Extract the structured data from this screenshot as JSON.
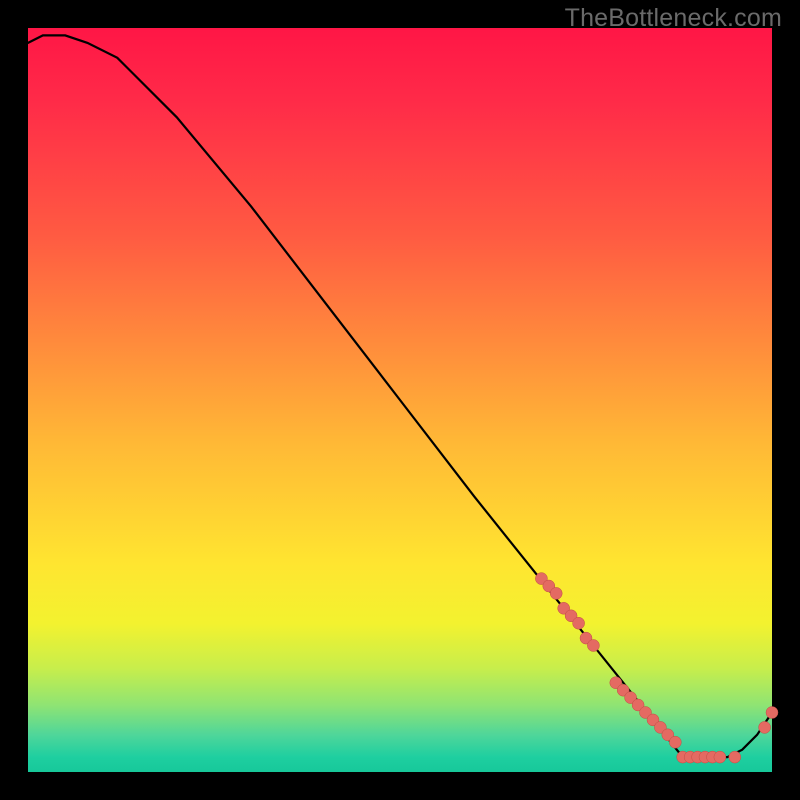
{
  "watermark": "TheBottleneck.com",
  "colors": {
    "background": "#000000",
    "watermark_text": "#6a6a6a",
    "curve": "#000000",
    "dot_fill": "#e46a62",
    "dot_stroke": "#c04d44",
    "gradient_stops": [
      "#ff1646",
      "#ff2b48",
      "#ff5b42",
      "#ff8a3c",
      "#ffb936",
      "#ffe530",
      "#f3f22f",
      "#c8ee4b",
      "#8fe473",
      "#4fd69a",
      "#1ecfa0",
      "#17c89a"
    ]
  },
  "chart_data": {
    "type": "line",
    "title": "",
    "xlabel": "",
    "ylabel": "",
    "xlim": [
      0,
      100
    ],
    "ylim": [
      0,
      100
    ],
    "axes_visible": false,
    "grid": false,
    "legend": false,
    "background": "rainbow-vertical-gradient red→green",
    "note": "Values are read off the plot area in percent of width (x) and percent of height (y, 0 = bottom). Curve rises slightly, falls steeply to ~(88, 2), flat along bottom to ~(95, 2), then rises to ~(100, 8).",
    "series": [
      {
        "name": "curve",
        "x": [
          0,
          2,
          5,
          8,
          12,
          20,
          30,
          40,
          50,
          60,
          68,
          72,
          76,
          80,
          84,
          88,
          90,
          92,
          94,
          96,
          98,
          100
        ],
        "y": [
          98,
          99,
          99,
          98,
          96,
          88,
          76,
          63,
          50,
          37,
          27,
          22,
          17,
          12,
          7,
          2,
          2,
          2,
          2,
          3,
          5,
          8
        ]
      }
    ],
    "points": {
      "name": "dots",
      "note": "Clustered along the lower-right portion of the curve.",
      "x": [
        69,
        70,
        71,
        72,
        73,
        74,
        75,
        76,
        79,
        80,
        81,
        82,
        83,
        84,
        85,
        86,
        87,
        88,
        89,
        90,
        91,
        92,
        93,
        95,
        99,
        100
      ],
      "y": [
        26,
        25,
        24,
        22,
        21,
        20,
        18,
        17,
        12,
        11,
        10,
        9,
        8,
        7,
        6,
        5,
        4,
        2,
        2,
        2,
        2,
        2,
        2,
        2,
        6,
        8
      ]
    }
  }
}
